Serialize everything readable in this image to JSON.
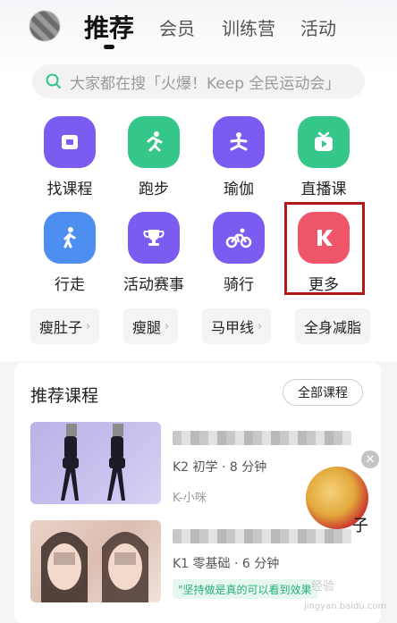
{
  "tabs": [
    {
      "label": "推荐",
      "active": true
    },
    {
      "label": "会员",
      "active": false
    },
    {
      "label": "训练营",
      "active": false
    },
    {
      "label": "活动",
      "active": false
    }
  ],
  "search": {
    "placeholder": "大家都在搜「火爆！Keep 全民运动会」"
  },
  "categories": [
    {
      "label": "找课程",
      "icon": "book-icon",
      "color": "#7b5cf0"
    },
    {
      "label": "跑步",
      "icon": "running-icon",
      "color": "#35c68a"
    },
    {
      "label": "瑜伽",
      "icon": "yoga-icon",
      "color": "#7b5cf0"
    },
    {
      "label": "直播课",
      "icon": "tv-icon",
      "color": "#35c68a"
    },
    {
      "label": "行走",
      "icon": "walking-icon",
      "color": "#4d8ff0"
    },
    {
      "label": "活动赛事",
      "icon": "trophy-icon",
      "color": "#7b5cf0"
    },
    {
      "label": "骑行",
      "icon": "bike-icon",
      "color": "#7b5cf0"
    },
    {
      "label": "更多",
      "icon": "keep-logo-icon",
      "color": "#f0566a"
    }
  ],
  "chips": [
    "瘦肚子",
    "瘦腿",
    "马甲线",
    "全身减脂"
  ],
  "section": {
    "title": "推荐课程",
    "all_label": "全部课程"
  },
  "courses": [
    {
      "meta": "K2 初学 · 8 分钟",
      "author": "K-小咪"
    },
    {
      "meta": "K1 零基础 · 6 分钟",
      "quote": "\"坚持做是真的可以看到效果"
    }
  ],
  "floating": {
    "text": "子",
    "close": "✕"
  },
  "watermark": {
    "line1": "经验",
    "line2": "jingyan.baidu.com"
  }
}
